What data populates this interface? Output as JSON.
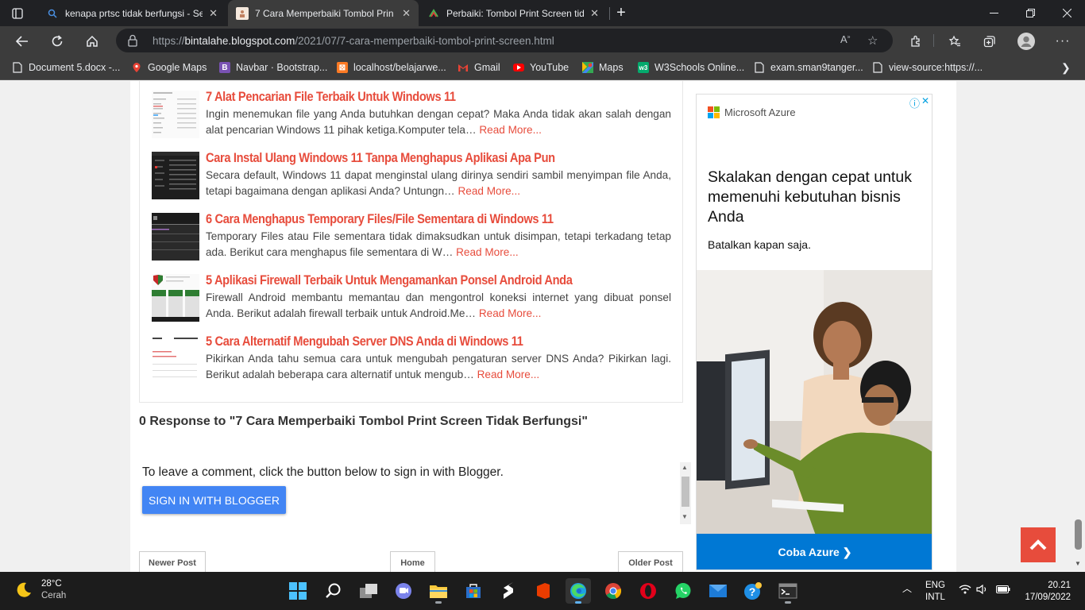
{
  "browser": {
    "tabs": [
      {
        "title": "kenapa prtsc tidak berfungsi - Se",
        "icon": "search-icon",
        "active": false
      },
      {
        "title": "7 Cara Memperbaiki Tombol Prin",
        "icon": "blogger-icon",
        "active": true
      },
      {
        "title": "Perbaiki: Tombol Print Screen tid",
        "icon": "blog-icon",
        "active": false
      }
    ],
    "new_tab_label": "+",
    "url_prefix": "https://",
    "url_host": "bintalahe.blogspot.com",
    "url_path": "/2021/07/7-cara-memperbaiki-tombol-print-screen.html",
    "bookmarks": [
      {
        "label": "Document 5.docx -...",
        "icon": "document-icon",
        "color": "#ffffff"
      },
      {
        "label": "Google Maps",
        "icon": "google-maps-icon",
        "color": "#ea4335"
      },
      {
        "label": "Navbar · Bootstrap...",
        "icon": "bootstrap-icon",
        "color": "#7952b3"
      },
      {
        "label": "localhost/belajarwe...",
        "icon": "xampp-icon",
        "color": "#fb7a24"
      },
      {
        "label": "Gmail",
        "icon": "gmail-icon",
        "color": "#ea4335"
      },
      {
        "label": "YouTube",
        "icon": "youtube-icon",
        "color": "#ff0000"
      },
      {
        "label": "Maps",
        "icon": "maps-icon",
        "color": "#34a853"
      },
      {
        "label": "W3Schools Online...",
        "icon": "w3schools-icon",
        "color": "#04aa6d"
      },
      {
        "label": "exam.sman9tanger...",
        "icon": "page-icon",
        "color": "#ffffff"
      },
      {
        "label": "view-source:https://...",
        "icon": "page-icon",
        "color": "#ffffff"
      }
    ]
  },
  "related": [
    {
      "title": "7 Alat Pencarian File Terbaik Untuk Windows 11",
      "text": "Ingin menemukan file yang Anda butuhkan dengan cepat? Maka Anda tidak akan salah dengan alat pencarian Windows 11 pihak ketiga.Komputer tela…",
      "more": "Read More..."
    },
    {
      "title": "Cara Instal Ulang Windows 11 Tanpa Menghapus Aplikasi Apa Pun",
      "text": "Secara default, Windows 11 dapat menginstal ulang dirinya sendiri sambil menyimpan file Anda, tetapi bagaimana dengan aplikasi Anda? Untungn…",
      "more": "Read More..."
    },
    {
      "title": "6 Cara Menghapus Temporary Files/File Sementara di Windows 11",
      "text": "Temporary Files atau File sementara tidak dimaksudkan untuk disimpan, tetapi terkadang tetap ada. Berikut cara menghapus file sementara di W…",
      "more": "Read More..."
    },
    {
      "title": "5 Aplikasi Firewall Terbaik Untuk Mengamankan Ponsel Android Anda",
      "text": "Firewall Android membantu memantau dan mengontrol koneksi internet yang dibuat ponsel Anda. Berikut adalah firewall terbaik untuk Android.Me…",
      "more": "Read More..."
    },
    {
      "title": "5 Cara Alternatif Mengubah Server DNS Anda di Windows 11",
      "text": "Pikirkan Anda tahu semua cara untuk mengubah pengaturan server DNS Anda? Pikirkan lagi. Berikut adalah beberapa cara alternatif untuk mengub…",
      "more": "Read More..."
    }
  ],
  "comments": {
    "heading": "0 Response to \"7 Cara Memperbaiki Tombol Print Screen Tidak Berfungsi\"",
    "prompt": "To leave a comment, click the button below to sign in with Blogger.",
    "signin_label": "SIGN IN WITH BLOGGER"
  },
  "pager": {
    "newer": "Newer Post",
    "home": "Home",
    "older": "Older Post"
  },
  "ad": {
    "brand": "Microsoft Azure",
    "headline": "Skalakan dengan cepat untuk memenuhi kebutuhan bisnis Anda",
    "sub": "Batalkan kapan saja.",
    "cta": "Coba Azure ❯",
    "info_icon": "ⓘ",
    "close_icon": "✕"
  },
  "taskbar": {
    "weather_temp": "28°C",
    "weather_desc": "Cerah",
    "lang_1": "ENG",
    "lang_2": "INTL",
    "time": "20.21",
    "date": "17/09/2022"
  },
  "colors": {
    "accent_red": "#e74c3c",
    "blogger_blue": "#4285f4",
    "azure_blue": "#0078d4"
  }
}
